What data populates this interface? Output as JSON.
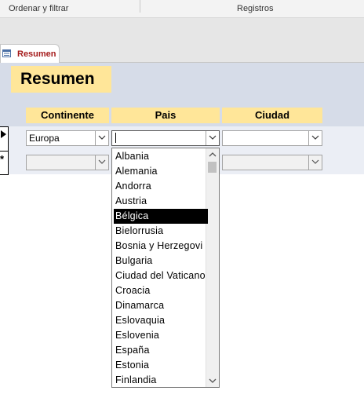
{
  "ribbon": {
    "group1": "Ordenar y filtrar",
    "group2": "Registros"
  },
  "tab": {
    "label": "Resumen",
    "icon": "form-icon"
  },
  "form": {
    "title": "Resumen",
    "columns": [
      "Continente",
      "Pais",
      "Ciudad"
    ],
    "row1": {
      "continente": "Europa",
      "pais": "",
      "ciudad": ""
    },
    "new_row_marker": "*"
  },
  "dropdown": {
    "selected_index": 4,
    "scroll_fraction": 0.0,
    "items": [
      "Albania",
      "Alemania",
      "Andorra",
      "Austria",
      "Bélgica",
      "Bielorrusia",
      "Bosnia y Herzegovi",
      "Bulgaria",
      "Ciudad del Vaticano",
      "Croacia",
      "Dinamarca",
      "Eslovaquia",
      "Eslovenia",
      "España",
      "Estonia",
      "Finlandia"
    ]
  },
  "colors": {
    "header_bg": "#d6dce8",
    "label_bg": "#ffe699",
    "tab_text": "#a51c1c",
    "selection": "#000000"
  }
}
